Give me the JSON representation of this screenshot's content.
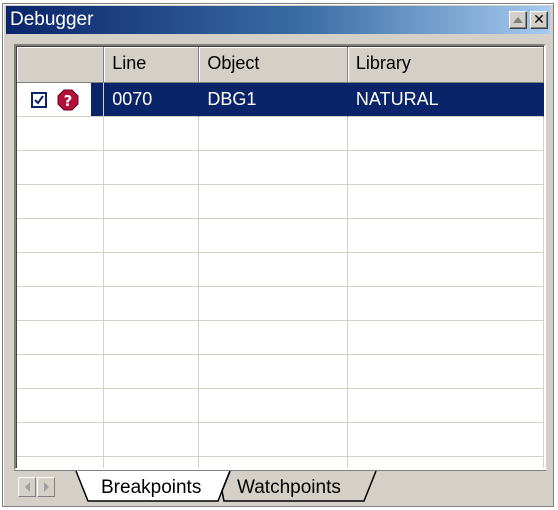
{
  "window": {
    "title": "Debugger"
  },
  "icons": {
    "restore": "restore-icon",
    "close": "close-icon",
    "checkbox": "checkbox-checked-icon",
    "breakpoint": "breakpoint-question-icon",
    "scroll_left": "scroll-left-icon",
    "scroll_right": "scroll-right-icon"
  },
  "colors": {
    "selection": "#0a246a",
    "breakpoint_icon": "#b0103a",
    "title_gradient_start": "#0a246a",
    "title_gradient_end": "#a6caf0"
  },
  "table": {
    "columns": [
      "",
      "Line",
      "Object",
      "Library"
    ],
    "rows": [
      {
        "enabled": true,
        "line": "0070",
        "object": "DBG1",
        "library": "NATURAL",
        "selected": true
      }
    ]
  },
  "tabs": [
    {
      "label": "Breakpoints",
      "active": true
    },
    {
      "label": "Watchpoints",
      "active": false
    }
  ]
}
